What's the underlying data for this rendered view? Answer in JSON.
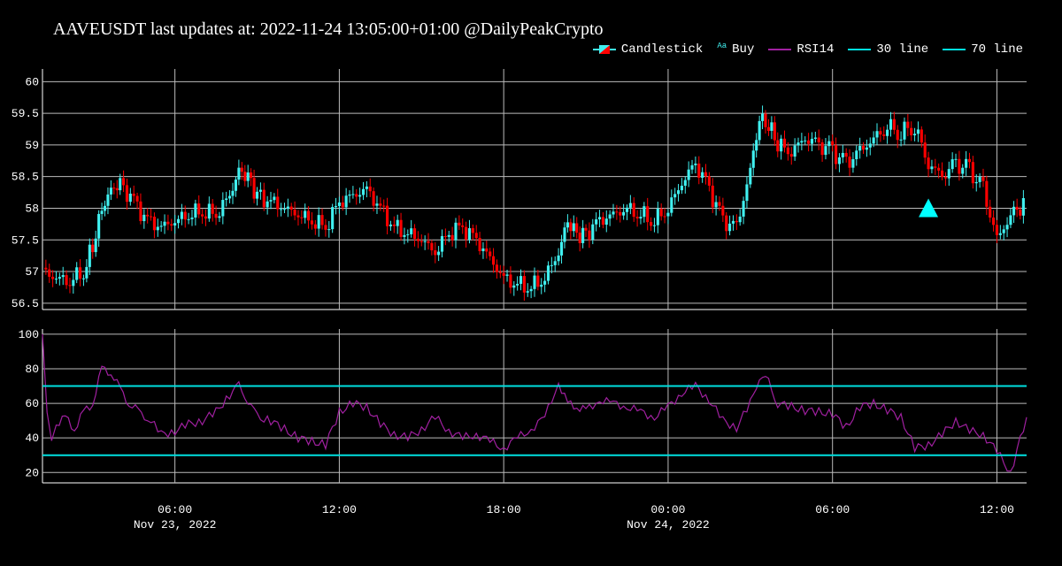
{
  "chart_data": [
    {
      "type": "candlestick",
      "title": "AAVEUSDT last updates at: 2022-11-24 13:05:00+01:00 @DailyPeakCrypto",
      "ylim": [
        56.4,
        60.2
      ],
      "yticks": [
        56.5,
        57,
        57.5,
        58,
        58.5,
        59,
        59.5,
        60
      ],
      "grid": true,
      "legend_placement": "top-right",
      "xrange": [
        "2022-11-23 01:10",
        "2022-11-24 13:05"
      ],
      "xticks": [
        {
          "at": "2022-11-23 06:00",
          "label": "06:00",
          "sublabel": "Nov 23, 2022"
        },
        {
          "at": "2022-11-23 12:00",
          "label": "12:00",
          "sublabel": ""
        },
        {
          "at": "2022-11-23 18:00",
          "label": "18:00",
          "sublabel": ""
        },
        {
          "at": "2022-11-24 00:00",
          "label": "00:00",
          "sublabel": "Nov 24, 2022"
        },
        {
          "at": "2022-11-24 06:00",
          "label": "06:00",
          "sublabel": ""
        },
        {
          "at": "2022-11-24 12:00",
          "label": "12:00",
          "sublabel": ""
        }
      ],
      "close_series": {
        "name": "Candlestick",
        "x": [
          "2022-11-23 01:10",
          "2022-11-23 01:40",
          "2022-11-23 02:10",
          "2022-11-23 02:40",
          "2022-11-23 03:00",
          "2022-11-23 03:20",
          "2022-11-23 03:40",
          "2022-11-23 04:00",
          "2022-11-23 04:30",
          "2022-11-23 05:00",
          "2022-11-23 05:30",
          "2022-11-23 06:00",
          "2022-11-23 06:30",
          "2022-11-23 07:00",
          "2022-11-23 07:30",
          "2022-11-23 08:00",
          "2022-11-23 08:20",
          "2022-11-23 08:40",
          "2022-11-23 09:00",
          "2022-11-23 09:30",
          "2022-11-23 10:00",
          "2022-11-23 10:30",
          "2022-11-23 11:00",
          "2022-11-23 11:30",
          "2022-11-23 12:00",
          "2022-11-23 12:30",
          "2022-11-23 13:00",
          "2022-11-23 13:30",
          "2022-11-23 14:00",
          "2022-11-23 14:30",
          "2022-11-23 15:00",
          "2022-11-23 15:30",
          "2022-11-23 16:00",
          "2022-11-23 16:30",
          "2022-11-23 17:00",
          "2022-11-23 17:30",
          "2022-11-23 18:00",
          "2022-11-23 18:30",
          "2022-11-23 19:00",
          "2022-11-23 19:30",
          "2022-11-23 20:00",
          "2022-11-23 20:20",
          "2022-11-23 20:40",
          "2022-11-23 21:00",
          "2022-11-23 21:30",
          "2022-11-23 22:00",
          "2022-11-23 22:30",
          "2022-11-23 23:00",
          "2022-11-23 23:30",
          "2022-11-24 00:00",
          "2022-11-24 00:30",
          "2022-11-24 01:00",
          "2022-11-24 01:30",
          "2022-11-24 02:00",
          "2022-11-24 02:30",
          "2022-11-24 03:00",
          "2022-11-24 03:20",
          "2022-11-24 03:40",
          "2022-11-24 04:00",
          "2022-11-24 04:30",
          "2022-11-24 05:00",
          "2022-11-24 05:30",
          "2022-11-24 06:00",
          "2022-11-24 06:30",
          "2022-11-24 07:00",
          "2022-11-24 07:30",
          "2022-11-24 08:00",
          "2022-11-24 08:30",
          "2022-11-24 09:00",
          "2022-11-24 09:30",
          "2022-11-24 10:00",
          "2022-11-24 10:30",
          "2022-11-24 11:00",
          "2022-11-24 11:30",
          "2022-11-24 12:00",
          "2022-11-24 12:30",
          "2022-11-24 13:05"
        ],
        "values": [
          57.0,
          56.9,
          56.85,
          57.0,
          57.4,
          58.0,
          58.3,
          58.4,
          58.1,
          57.8,
          57.7,
          57.8,
          57.9,
          57.95,
          57.9,
          58.2,
          58.6,
          58.5,
          58.2,
          58.1,
          58.0,
          57.9,
          57.8,
          57.7,
          58.1,
          58.2,
          58.3,
          58.0,
          57.7,
          57.6,
          57.5,
          57.3,
          57.6,
          57.7,
          57.5,
          57.2,
          56.9,
          56.8,
          56.75,
          56.9,
          57.3,
          57.8,
          57.6,
          57.6,
          57.8,
          57.9,
          58.0,
          57.9,
          57.8,
          58.0,
          58.4,
          58.7,
          58.3,
          57.8,
          57.7,
          58.6,
          59.4,
          59.3,
          59.0,
          58.9,
          59.1,
          59.0,
          58.9,
          58.7,
          58.9,
          59.1,
          59.3,
          59.2,
          59.3,
          58.7,
          58.5,
          58.7,
          58.6,
          58.3,
          57.5,
          57.9,
          58.1
        ]
      },
      "markers": [
        {
          "name": "Buy",
          "shape": "triangle-up",
          "x": "2022-11-24 09:30",
          "y": 58.0
        }
      ],
      "colors": {
        "up": "#40f0f0",
        "down": "#ff0000",
        "buy": "#00ffff"
      }
    },
    {
      "type": "line",
      "ylim": [
        14,
        103
      ],
      "yticks": [
        20,
        40,
        60,
        80,
        100
      ],
      "grid": true,
      "series": [
        {
          "name": "RSI14",
          "color": "#a020a0",
          "x": [
            "2022-11-23 01:10",
            "2022-11-23 01:20",
            "2022-11-23 01:30",
            "2022-11-23 01:40",
            "2022-11-23 02:00",
            "2022-11-23 02:20",
            "2022-11-23 02:40",
            "2022-11-23 03:00",
            "2022-11-23 03:20",
            "2022-11-23 03:40",
            "2022-11-23 04:00",
            "2022-11-23 04:20",
            "2022-11-23 04:40",
            "2022-11-23 05:00",
            "2022-11-23 05:30",
            "2022-11-23 06:00",
            "2022-11-23 06:30",
            "2022-11-23 07:00",
            "2022-11-23 07:30",
            "2022-11-23 08:00",
            "2022-11-23 08:20",
            "2022-11-23 08:40",
            "2022-11-23 09:00",
            "2022-11-23 09:30",
            "2022-11-23 10:00",
            "2022-11-23 10:30",
            "2022-11-23 11:00",
            "2022-11-23 11:30",
            "2022-11-23 12:00",
            "2022-11-23 12:30",
            "2022-11-23 13:00",
            "2022-11-23 13:30",
            "2022-11-23 14:00",
            "2022-11-23 14:30",
            "2022-11-23 15:00",
            "2022-11-23 15:30",
            "2022-11-23 16:00",
            "2022-11-23 16:30",
            "2022-11-23 17:00",
            "2022-11-23 17:30",
            "2022-11-23 18:00",
            "2022-11-23 18:30",
            "2022-11-23 19:00",
            "2022-11-23 19:30",
            "2022-11-23 20:00",
            "2022-11-23 20:20",
            "2022-11-23 20:40",
            "2022-11-23 21:00",
            "2022-11-23 21:30",
            "2022-11-23 22:00",
            "2022-11-23 22:30",
            "2022-11-23 23:00",
            "2022-11-23 23:30",
            "2022-11-24 00:00",
            "2022-11-24 00:30",
            "2022-11-24 01:00",
            "2022-11-24 01:30",
            "2022-11-24 02:00",
            "2022-11-24 02:30",
            "2022-11-24 03:00",
            "2022-11-24 03:20",
            "2022-11-24 03:40",
            "2022-11-24 04:00",
            "2022-11-24 04:30",
            "2022-11-24 05:00",
            "2022-11-24 05:30",
            "2022-11-24 06:00",
            "2022-11-24 06:30",
            "2022-11-24 07:00",
            "2022-11-24 07:30",
            "2022-11-24 08:00",
            "2022-11-24 08:30",
            "2022-11-24 09:00",
            "2022-11-24 09:30",
            "2022-11-24 10:00",
            "2022-11-24 10:30",
            "2022-11-24 11:00",
            "2022-11-24 11:30",
            "2022-11-24 12:00",
            "2022-11-24 12:30",
            "2022-11-24 13:05"
          ],
          "values": [
            100,
            55,
            38,
            48,
            52,
            45,
            55,
            60,
            80,
            78,
            68,
            60,
            55,
            52,
            42,
            44,
            48,
            50,
            55,
            65,
            70,
            62,
            52,
            50,
            45,
            40,
            38,
            36,
            55,
            60,
            58,
            48,
            42,
            40,
            45,
            52,
            44,
            40,
            42,
            38,
            34,
            40,
            45,
            52,
            72,
            60,
            58,
            56,
            62,
            60,
            58,
            55,
            52,
            58,
            66,
            70,
            62,
            50,
            46,
            60,
            76,
            72,
            60,
            58,
            56,
            55,
            54,
            46,
            58,
            60,
            56,
            52,
            34,
            36,
            42,
            50,
            44,
            42,
            32,
            20,
            52
          ]
        },
        {
          "name": "30 line",
          "color": "#00e0e0",
          "constant": 30
        },
        {
          "name": "70 line",
          "color": "#00e0e0",
          "constant": 70
        }
      ]
    }
  ],
  "legend": [
    {
      "label": "Candlestick",
      "kind": "candle"
    },
    {
      "label": "Buy",
      "kind": "marker"
    },
    {
      "label": "RSI14",
      "kind": "line",
      "color": "#a020a0"
    },
    {
      "label": "30 line",
      "kind": "line",
      "color": "#00e0e0"
    },
    {
      "label": "70 line",
      "kind": "line",
      "color": "#00e0e0"
    }
  ]
}
